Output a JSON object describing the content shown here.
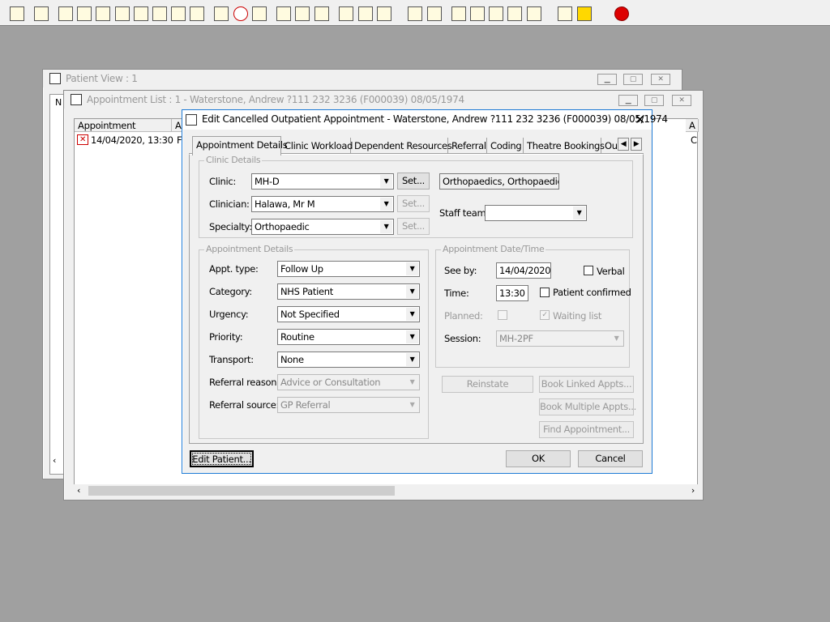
{
  "toolbar": {
    "icons": [
      "patient-icon",
      "print-icon",
      "folder-icon",
      "folder-edit-icon",
      "notes-icon",
      "letter-m-icon",
      "doctor-icon",
      "edit-icon",
      "id-card-icon",
      "id-card-2-icon",
      "tools-icon",
      "clock-icon",
      "monitor-icon",
      "chart-icon",
      "chart-edit-icon",
      "time-icon",
      "notepad-icon",
      "transfer-icon",
      "ambulance-icon",
      "document-icon",
      "bar-chart-icon",
      "globe-icon",
      "checklist-icon",
      "checklist-edit-icon",
      "refresh-icon",
      "next-icon",
      "swap-icon",
      "warning-icon",
      "exit-icon"
    ]
  },
  "patient_view": {
    "title": "Patient View : 1",
    "col_n": "N"
  },
  "appointment_list": {
    "title": "Appointment List : 1 - Waterstone, Andrew ?111 232 3236 (F000039) 08/05/1974",
    "columns": [
      "Appointment",
      "A"
    ],
    "col_right": "A",
    "row": {
      "appointment": "14/04/2020, 13:30",
      "a": "F",
      "right": "C"
    }
  },
  "dialog": {
    "title": "Edit Cancelled Outpatient Appointment - Waterstone, Andrew ?111 232 3236 (F000039) 08/05/1974",
    "tabs": [
      "Appointment Details",
      "Clinic Workload",
      "Dependent Resources",
      "Referral",
      "Coding",
      "Theatre Bookings",
      "Out"
    ],
    "clinic_details": {
      "legend": "Clinic Details",
      "clinic_label": "Clinic:",
      "clinic_value": "MH-D",
      "clinician_label": "Clinician:",
      "clinician_value": "Halawa, Mr M",
      "specialty_label": "Specialty:",
      "specialty_value": "Orthopaedic",
      "set_label": "Set...",
      "clinic_desc": "Orthopaedics, Orthopaedic OP",
      "staff_team_label": "Staff team:",
      "staff_team_value": ""
    },
    "appt_details": {
      "legend": "Appointment Details",
      "fields": [
        {
          "label": "Appt. type:",
          "value": "Follow Up"
        },
        {
          "label": "Category:",
          "value": "NHS Patient"
        },
        {
          "label": "Urgency:",
          "value": "Not Specified"
        },
        {
          "label": "Priority:",
          "value": "Routine"
        },
        {
          "label": "Transport:",
          "value": "None"
        },
        {
          "label": "Referral reason:",
          "value": "Advice or Consultation"
        },
        {
          "label": "Referral source:",
          "value": "GP Referral"
        }
      ]
    },
    "datetime": {
      "legend": "Appointment Date/Time",
      "see_by_label": "See by:",
      "see_by_value": "14/04/2020",
      "verbal_label": "Verbal",
      "time_label": "Time:",
      "time_value": "13:30",
      "patient_confirmed_label": "Patient confirmed",
      "planned_label": "Planned:",
      "waiting_list_label": "Waiting list",
      "session_label": "Session:",
      "session_value": "MH-2PF"
    },
    "buttons": {
      "reinstate": "Reinstate",
      "book_linked": "Book Linked Appts...",
      "book_multiple": "Book Multiple Appts...",
      "find_appointment": "Find Appointment...",
      "edit_patient": "Edit Patient...",
      "ok": "OK",
      "cancel": "Cancel"
    }
  }
}
